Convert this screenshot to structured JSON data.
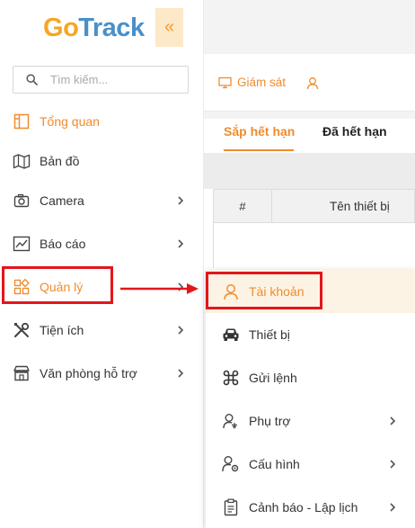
{
  "brand": {
    "logo_text_o": "o",
    "logo_text_rest": "Track",
    "logo_g": "G",
    "collapse_glyph": "«"
  },
  "search": {
    "placeholder": "Tìm kiếm..."
  },
  "sidebar": {
    "items": [
      {
        "label": "Tổng quan",
        "icon": "dashboard-icon",
        "active": true,
        "has_children": false
      },
      {
        "label": "Bản đồ",
        "icon": "map-icon",
        "active": false,
        "has_children": false
      },
      {
        "label": "Camera",
        "icon": "camera-icon",
        "active": false,
        "has_children": true
      },
      {
        "label": "Báo cáo",
        "icon": "chart-icon",
        "active": false,
        "has_children": true
      },
      {
        "label": "Quản lý",
        "icon": "grid-icon",
        "active": true,
        "has_children": true
      },
      {
        "label": "Tiện ích",
        "icon": "tools-icon",
        "active": false,
        "has_children": true
      },
      {
        "label": "Văn phòng hỗ trợ",
        "icon": "store-icon",
        "active": false,
        "has_children": true
      }
    ]
  },
  "toolbar": {
    "monitor_label": "Giám sát"
  },
  "tabs": [
    {
      "label": "Sắp hết hạn",
      "active": true
    },
    {
      "label": "Đã hết hạn",
      "active": false
    }
  ],
  "table": {
    "columns": [
      "#",
      "Tên thiết bị"
    ]
  },
  "submenu": {
    "items": [
      {
        "label": "Tài khoản",
        "icon": "user-icon",
        "active": true,
        "has_children": false
      },
      {
        "label": "Thiết bị",
        "icon": "car-icon",
        "active": false,
        "has_children": false
      },
      {
        "label": "Gửi lệnh",
        "icon": "command-icon",
        "active": false,
        "has_children": false
      },
      {
        "label": "Phụ trợ",
        "icon": "user-settings-icon",
        "active": false,
        "has_children": true
      },
      {
        "label": "Cấu hình",
        "icon": "user-gear-icon",
        "active": false,
        "has_children": true
      },
      {
        "label": "Cảnh báo - Lập lịch",
        "icon": "clipboard-icon",
        "active": false,
        "has_children": true
      }
    ]
  },
  "colors": {
    "accent": "#f08c2e",
    "highlight_red": "#e3161c",
    "logo_blue": "#4a90c8",
    "logo_orange": "#f5a623"
  }
}
